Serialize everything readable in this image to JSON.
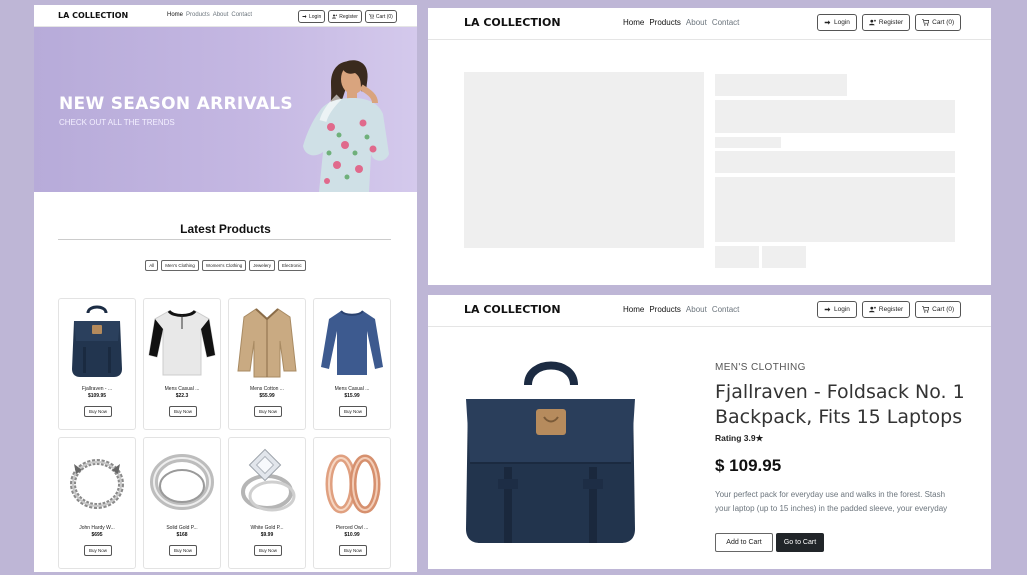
{
  "nav": {
    "brand": "LA COLLECTION",
    "links": [
      "Home",
      "Products",
      "About",
      "Contact"
    ],
    "login": "Login",
    "register": "Register",
    "cart": "Cart (0)"
  },
  "hero": {
    "title": "NEW SEASON ARRIVALS",
    "subtitle": "CHECK OUT ALL THE TRENDS"
  },
  "products_section": {
    "title": "Latest Products",
    "filters": [
      "All",
      "Men's Clothing",
      "Women's Clothing",
      "Jewelery",
      "Electronic"
    ],
    "buy_label": "Buy Now",
    "items": [
      {
        "title": "Fjallraven - ...",
        "price": "$109.95",
        "icon": "backpack-image"
      },
      {
        "title": "Mens Casual ...",
        "price": "$22.3",
        "icon": "henley-shirt-image"
      },
      {
        "title": "Mens Cotton ...",
        "price": "$55.99",
        "icon": "cotton-jacket-image"
      },
      {
        "title": "Mens Casual ...",
        "price": "$15.99",
        "icon": "slim-fit-shirt-image"
      },
      {
        "title": "John Hardy W...",
        "price": "$695",
        "icon": "dragon-bracelet-image"
      },
      {
        "title": "Solid Gold P...",
        "price": "$168",
        "icon": "gold-ring-image"
      },
      {
        "title": "White Gold P...",
        "price": "$9.99",
        "icon": "princess-ring-image"
      },
      {
        "title": "Pierced Owl ...",
        "price": "$10.99",
        "icon": "rose-gold-earrings-image"
      }
    ]
  },
  "product_detail": {
    "category": "MEN'S CLOTHING",
    "name": "Fjallraven - Foldsack No. 1 Backpack, Fits 15 Laptops",
    "rating": "Rating 3.9★",
    "price": "$ 109.95",
    "description": "Your perfect pack for everyday use and walks in the forest. Stash your laptop (up to 15 inches) in the padded sleeve, your everyday",
    "add_to_cart": "Add to Cart",
    "go_to_cart": "Go to Cart"
  },
  "colors": {
    "background": "#beb6d6",
    "hero": "#c4b7e2",
    "dark_button": "#212529",
    "skeleton": "#efefef"
  }
}
